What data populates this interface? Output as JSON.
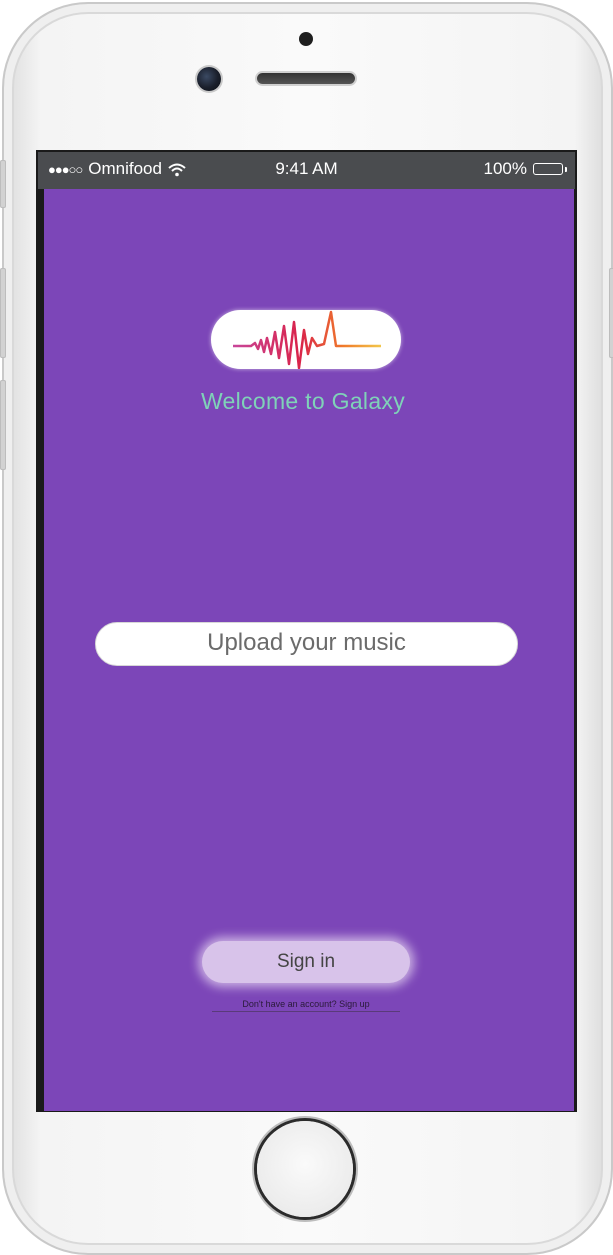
{
  "status_bar": {
    "signal": "●●●○○",
    "carrier": "Omnifood",
    "wifi_icon": "wifi-icon",
    "time": "9:41 AM",
    "battery_percent": "100%",
    "battery_icon": "battery-icon"
  },
  "app": {
    "background_color": "#7c46b8",
    "logo_icon": "sound-wave-logo-icon",
    "welcome_text": "Welcome to Galaxy",
    "upload_label": "Upload your music",
    "signin_label": "Sign in",
    "signup_link": "Don't have an account? Sign up"
  }
}
